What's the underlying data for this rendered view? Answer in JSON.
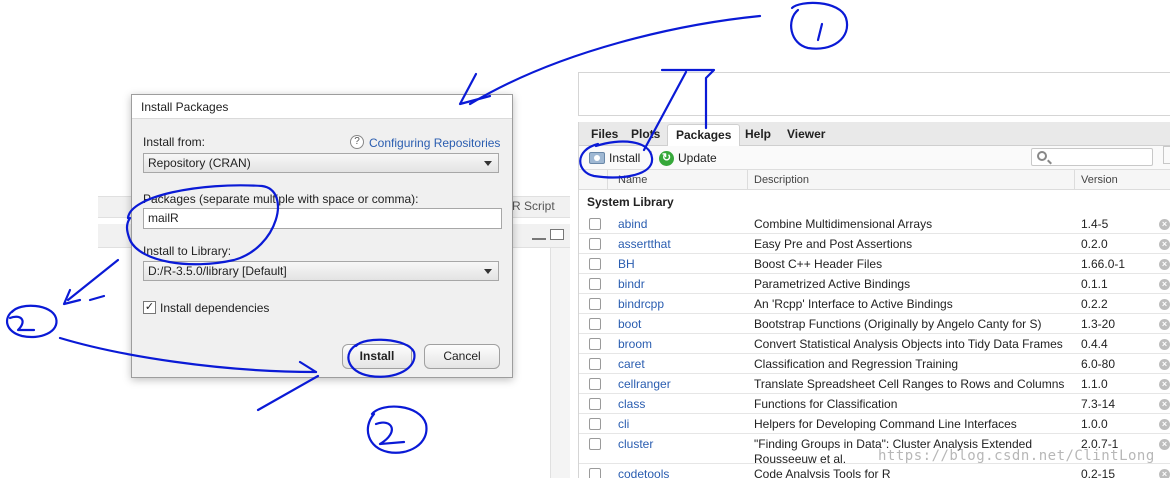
{
  "left_pane": {
    "source_type_label": "R Script"
  },
  "dialog": {
    "title": "Install Packages",
    "install_from_label": "Install from:",
    "help_icon": "question-icon",
    "help_link": "Configuring Repositories",
    "install_from_value": "Repository (CRAN)",
    "packages_label": "Packages (separate multiple with space or comma):",
    "packages_value": "mailR",
    "library_label": "Install to Library:",
    "library_value": "D:/R-3.5.0/library [Default]",
    "dependencies_label": "Install dependencies",
    "dependencies_checked": "✓",
    "install_button": "Install",
    "cancel_button": "Cancel"
  },
  "right_pane": {
    "tabs": [
      {
        "label": "Files"
      },
      {
        "label": "Plots"
      },
      {
        "label": "Packages"
      },
      {
        "label": "Help"
      },
      {
        "label": "Viewer"
      }
    ],
    "active_tab": "Packages",
    "toolbar": {
      "install_label": "Install",
      "update_label": "Update",
      "update_icon_glyph": "↻"
    },
    "columns": {
      "name": "Name",
      "description": "Description",
      "version": "Version"
    },
    "section_title": "System Library",
    "packages": [
      {
        "name": "abind",
        "description": "Combine Multidimensional Arrays",
        "version": "1.4-5"
      },
      {
        "name": "assertthat",
        "description": "Easy Pre and Post Assertions",
        "version": "0.2.0"
      },
      {
        "name": "BH",
        "description": "Boost C++ Header Files",
        "version": "1.66.0-1"
      },
      {
        "name": "bindr",
        "description": "Parametrized Active Bindings",
        "version": "0.1.1"
      },
      {
        "name": "bindrcpp",
        "description": "An 'Rcpp' Interface to Active Bindings",
        "version": "0.2.2"
      },
      {
        "name": "boot",
        "description": "Bootstrap Functions (Originally by Angelo Canty for S)",
        "version": "1.3-20"
      },
      {
        "name": "broom",
        "description": "Convert Statistical Analysis Objects into Tidy Data Frames",
        "version": "0.4.4"
      },
      {
        "name": "caret",
        "description": "Classification and Regression Training",
        "version": "6.0-80"
      },
      {
        "name": "cellranger",
        "description": "Translate Spreadsheet Cell Ranges to Rows and Columns",
        "version": "1.1.0"
      },
      {
        "name": "class",
        "description": "Functions for Classification",
        "version": "7.3-14"
      },
      {
        "name": "cli",
        "description": "Helpers for Developing Command Line Interfaces",
        "version": "1.0.0"
      },
      {
        "name": "cluster",
        "description": "\"Finding Groups in Data\": Cluster Analysis Extended Rousseeuw et al.",
        "version": "2.0.7-1"
      },
      {
        "name": "codetools",
        "description": "Code Analysis Tools for R",
        "version": "0.2-15"
      }
    ],
    "remove_icon_glyph": "×"
  },
  "annotations": {
    "color": "#0a1ad6",
    "markers": [
      "1",
      "2",
      "2"
    ],
    "watermark": "https://blog.csdn.net/ClintLong"
  }
}
